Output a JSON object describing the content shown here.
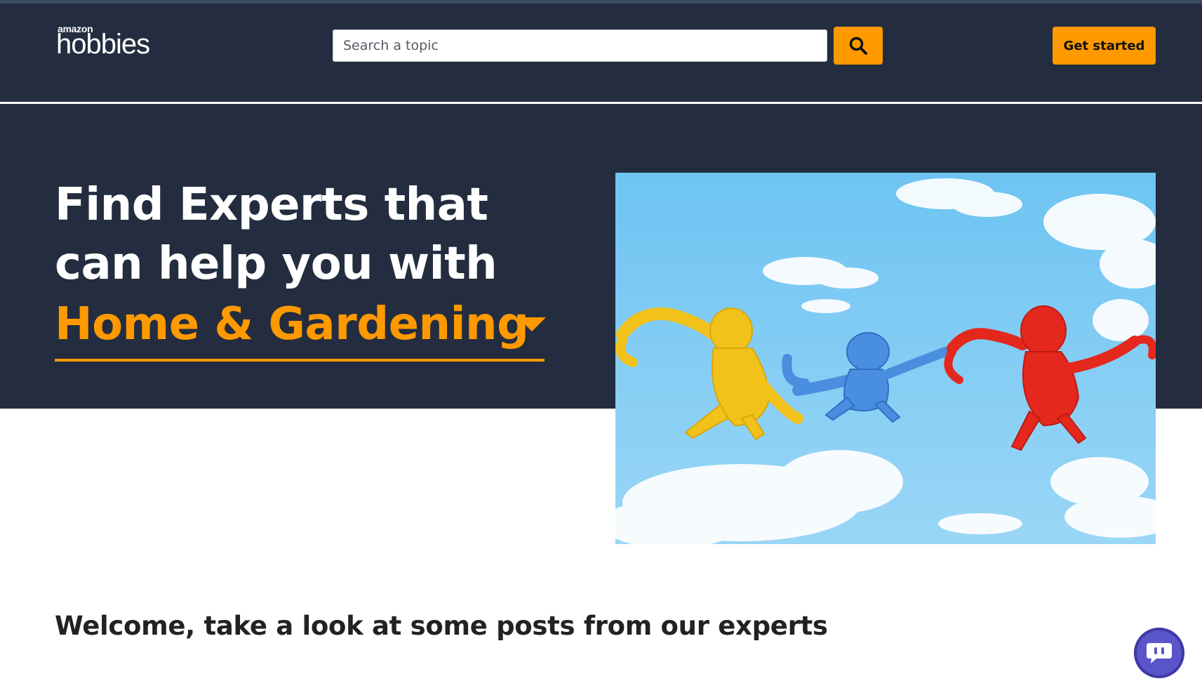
{
  "header": {
    "logo_small": "amazon",
    "logo_main": "hobbies",
    "search_placeholder": "Search a topic",
    "search_icon": "search-icon",
    "get_started_label": "Get started"
  },
  "hero": {
    "title": "Find Experts that can help you with",
    "topic_selected": "Home & Gardening",
    "dropdown_icon": "caret-down-icon",
    "image_subject": "hero-image"
  },
  "main": {
    "welcome_text": "Welcome, take a look at some posts from our experts"
  },
  "chat": {
    "icon": "chat-bubble-icon"
  },
  "colors": {
    "header_bg": "#232d3f",
    "accent": "#ff9900",
    "chat": "#5a55c9"
  }
}
